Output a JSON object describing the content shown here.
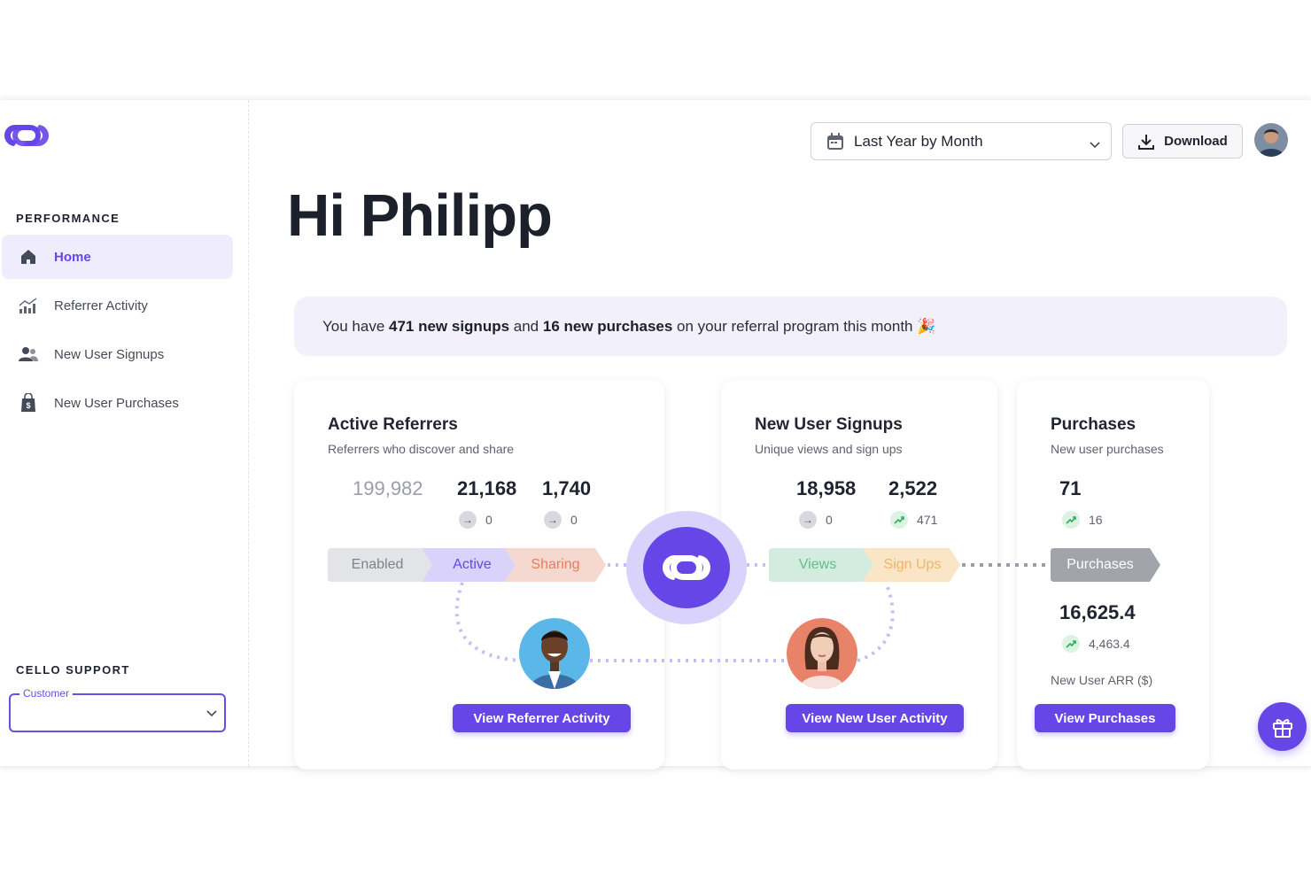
{
  "brand": {
    "accent": "#6646e6",
    "accent_light": "#d9d3fb",
    "logo": "cello-logo-icon"
  },
  "sidebar": {
    "performance_title": "PERFORMANCE",
    "items": [
      {
        "label": "Home",
        "icon": "home-icon",
        "active": true
      },
      {
        "label": "Referrer Activity",
        "icon": "bar-chart-icon",
        "active": false
      },
      {
        "label": "New User Signups",
        "icon": "users-icon",
        "active": false
      },
      {
        "label": "New User Purchases",
        "icon": "shopping-bag-icon",
        "active": false
      }
    ],
    "support_title": "CELLO SUPPORT",
    "support_select": {
      "legend": "Customer",
      "value": ""
    }
  },
  "topbar": {
    "period_select": "Last Year by Month",
    "download_label": "Download"
  },
  "greeting": "Hi Philipp",
  "banner": {
    "prefix": "You have ",
    "signups": "471 new signups",
    "middle": " and ",
    "purchases": "16 new purchases",
    "suffix": " on your referral program this month 🎉"
  },
  "cards": {
    "referrers": {
      "title": "Active Referrers",
      "subtitle": "Referrers who discover and share",
      "stats": [
        "199,982",
        "21,168",
        "1,740"
      ],
      "deltas": [
        "0",
        "0"
      ],
      "stages": [
        "Enabled",
        "Active",
        "Sharing"
      ],
      "button": "View Referrer Activity"
    },
    "signups": {
      "title": "New User Signups",
      "subtitle": "Unique views and sign ups",
      "stats": [
        "18,958",
        "2,522"
      ],
      "deltas": [
        "0",
        "471"
      ],
      "stages": [
        "Views",
        "Sign Ups"
      ],
      "button": "View New User Activity"
    },
    "purchases": {
      "title": "Purchases",
      "subtitle": "New user purchases",
      "stat": "71",
      "delta": "16",
      "stage": "Purchases",
      "arr_value": "16,625.4",
      "arr_delta": "4,463.4",
      "arr_label": "New User ARR ($)",
      "button": "View Purchases"
    }
  },
  "gift_icon": "gift-icon"
}
